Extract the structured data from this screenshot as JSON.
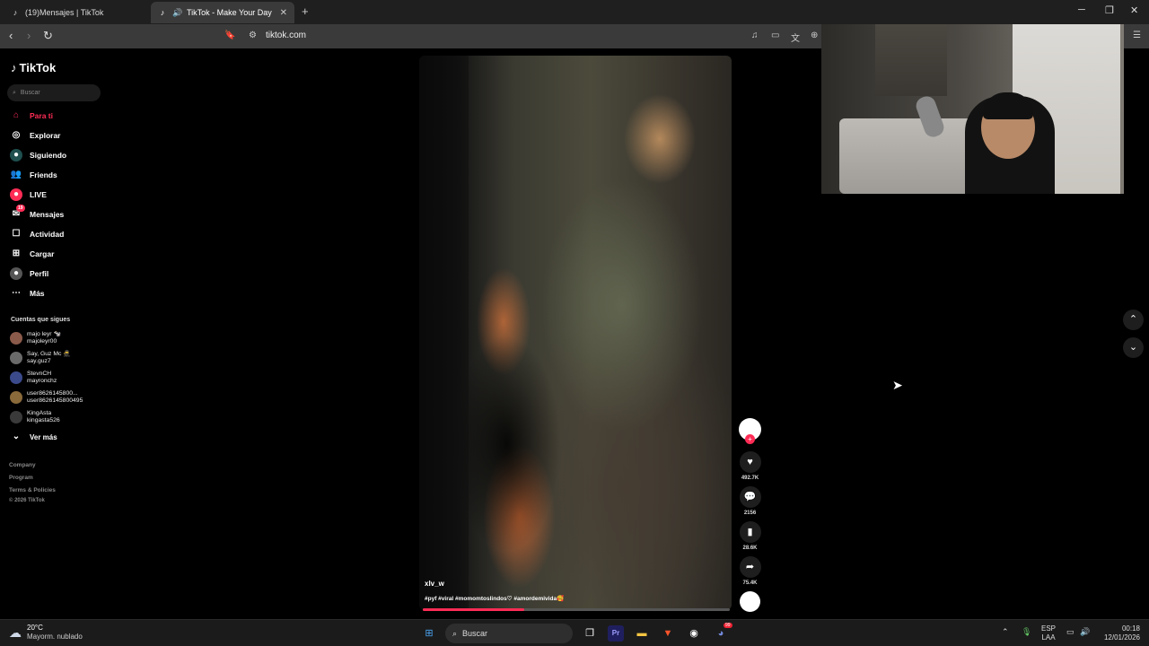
{
  "browser": {
    "tabs": [
      {
        "title": "(19)Mensajes | TikTok"
      },
      {
        "title": "TikTok - Make Your Day"
      }
    ],
    "url": "tiktok.com"
  },
  "tiktok": {
    "logo_text": "TikTok",
    "search_placeholder": "Buscar",
    "nav": [
      {
        "label": "Para ti",
        "icon": "home-icon",
        "active": true
      },
      {
        "label": "Explorar",
        "icon": "compass-icon"
      },
      {
        "label": "Siguiendo",
        "icon": "following-icon"
      },
      {
        "label": "Friends",
        "icon": "friends-icon"
      },
      {
        "label": "LIVE",
        "icon": "live-icon"
      },
      {
        "label": "Mensajes",
        "icon": "messages-icon",
        "badge": "19"
      },
      {
        "label": "Actividad",
        "icon": "activity-icon"
      },
      {
        "label": "Cargar",
        "icon": "upload-icon"
      },
      {
        "label": "Perfil",
        "icon": "profile-icon"
      },
      {
        "label": "Más",
        "icon": "more-icon"
      }
    ],
    "following_title": "Cuentas que sigues",
    "following": [
      {
        "name": "majo leyr 🐄",
        "handle": "majoleyr00"
      },
      {
        "name": "Say, Guz Mc 🥷",
        "handle": "say.guz7"
      },
      {
        "name": "StevnCH",
        "handle": "mayronchz"
      },
      {
        "name": "user8626145800...",
        "handle": "user8626145800495"
      },
      {
        "name": "KingAsta",
        "handle": "kingasta526"
      }
    ],
    "see_more": "Ver más",
    "footer": [
      "Company",
      "Program",
      "Terms & Policies",
      "© 2026 TikTok"
    ],
    "video": {
      "username": "xlv_w",
      "caption": "#pyf #viral #momomtoslindos♡ #amordemivida🥰",
      "progress": 0.33
    },
    "actions": {
      "likes": "492.7K",
      "comments": "2156",
      "saves": "28.6K",
      "shares": "75.4K"
    }
  },
  "taskbar": {
    "weather_temp": "20°C",
    "weather_desc": "Mayorm. nublado",
    "search_label": "Buscar",
    "lang_1": "ESP",
    "lang_2": "LAA",
    "time": "00:18",
    "date": "12/01/2026",
    "discord_badge": "99"
  }
}
